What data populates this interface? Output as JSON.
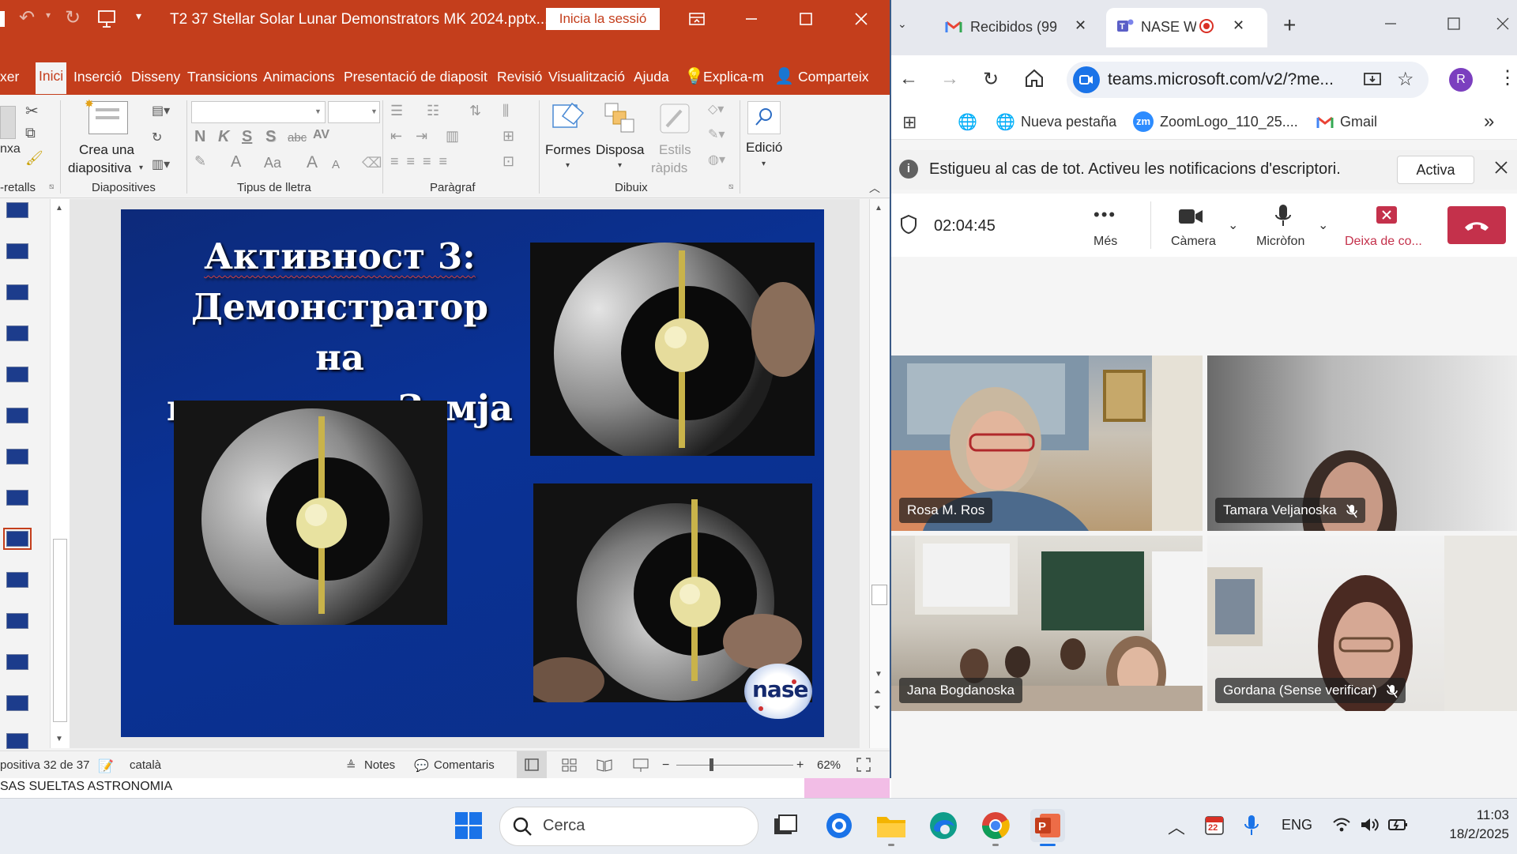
{
  "powerpoint": {
    "title": "T2 37 Stellar Solar Lunar Demonstrators MK 2024.pptx...",
    "signin_label": "Inicia la sessió",
    "tabs": [
      "xer",
      "Inici",
      "Inserció",
      "Disseny",
      "Transicions",
      "Animacions",
      "Presentació de diaposit",
      "Revisió",
      "Visualització",
      "Ajuda",
      "Explica-m",
      "Comparteix"
    ],
    "ribbon": {
      "paste_label": "nxa",
      "clipboard_group": "-retalls",
      "new_slide_label": "Crea una",
      "new_slide_label2": "diapositiva",
      "slides_group": "Diapositives",
      "font_group": "Tipus de lletra",
      "bold": "N",
      "italic": "K",
      "underline": "S",
      "shadow": "S",
      "strike": "abc",
      "spacing": "AV",
      "font_color": "A",
      "font_size_change": "Aa",
      "grow": "A",
      "shrink": "A",
      "paragraph_group": "Paràgraf",
      "shapes_label": "Formes",
      "arrange_label": "Disposa",
      "styles_label": "Estils",
      "styles_label2": "ràpids",
      "drawing_group": "Dibuix",
      "editing_label": "Edició"
    },
    "slide": {
      "title_line1": "Активност 3:",
      "title_line2": "Демонстратор на",
      "title_line3": "паралелна Земја",
      "logo_text": "nase"
    },
    "status": {
      "slide_counter": "positiva 32 de 37",
      "language": "català",
      "notes": "Notes",
      "comments": "Comentaris",
      "zoom": "62%"
    },
    "strip_text": "SAS SUELTAS ASTRONOMIA"
  },
  "browser": {
    "tabs": [
      {
        "label": "Recibidos (99",
        "icon": "gmail-icon"
      },
      {
        "label": "NASE Wo",
        "icon": "teams-icon"
      }
    ],
    "new_tab": "+",
    "url": "teams.microsoft.com/v2/?me...",
    "profile_initial": "R",
    "bookmarks": [
      "Nueva pestaña",
      "ZoomLogo_110_25....",
      "Gmail"
    ],
    "zoom_badge": "zm",
    "notification": {
      "text": "Estigueu al cas de tot. Activeu les notificacions d'escriptori.",
      "button": "Activa"
    },
    "meeting": {
      "timer": "02:04:45",
      "more": "Més",
      "camera": "Càmera",
      "mic": "Micròfon",
      "share": "Deixa de co...",
      "participants": [
        {
          "name": "Rosa M. Ros",
          "muted": false
        },
        {
          "name": "Tamara Veljanoska",
          "muted": true
        },
        {
          "name": "Jana Bogdanoska",
          "muted": false
        },
        {
          "name": "Gordana (Sense verificar)",
          "muted": true
        }
      ]
    }
  },
  "taskbar": {
    "search_placeholder": "Cerca",
    "language": "ENG",
    "time": "11:03",
    "date": "18/2/2025",
    "calendar_badge": "22"
  },
  "colors": {
    "ppt_accent": "#c43e1c",
    "teams_purple": "#5b5fc7",
    "leave_red": "#c4314b",
    "slide_blue": "#0a3296"
  }
}
